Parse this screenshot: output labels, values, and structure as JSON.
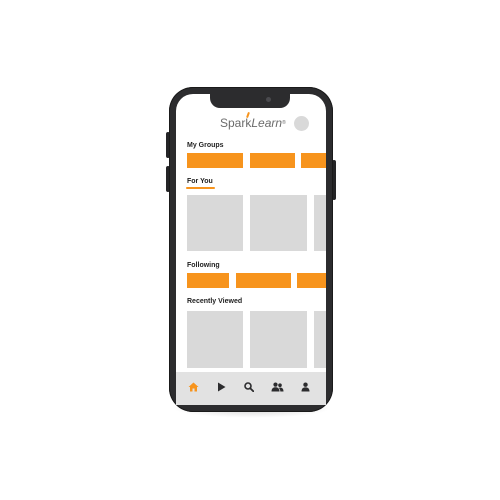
{
  "app": {
    "brand_part1": "Spark",
    "brand_part2": "Learn",
    "brand_tm": "®",
    "accent_color": "#f7941d",
    "placeholder_color": "#d9d9d9"
  },
  "sections": {
    "my_groups": "My Groups",
    "for_you": "For You",
    "following": "Following",
    "recently_viewed": "Recently Viewed"
  },
  "tabbar": {
    "items": [
      {
        "icon": "home-icon",
        "active": true
      },
      {
        "icon": "play-icon",
        "active": false
      },
      {
        "icon": "search-icon",
        "active": false
      },
      {
        "icon": "groups-icon",
        "active": false
      },
      {
        "icon": "profile-icon",
        "active": false
      }
    ]
  }
}
